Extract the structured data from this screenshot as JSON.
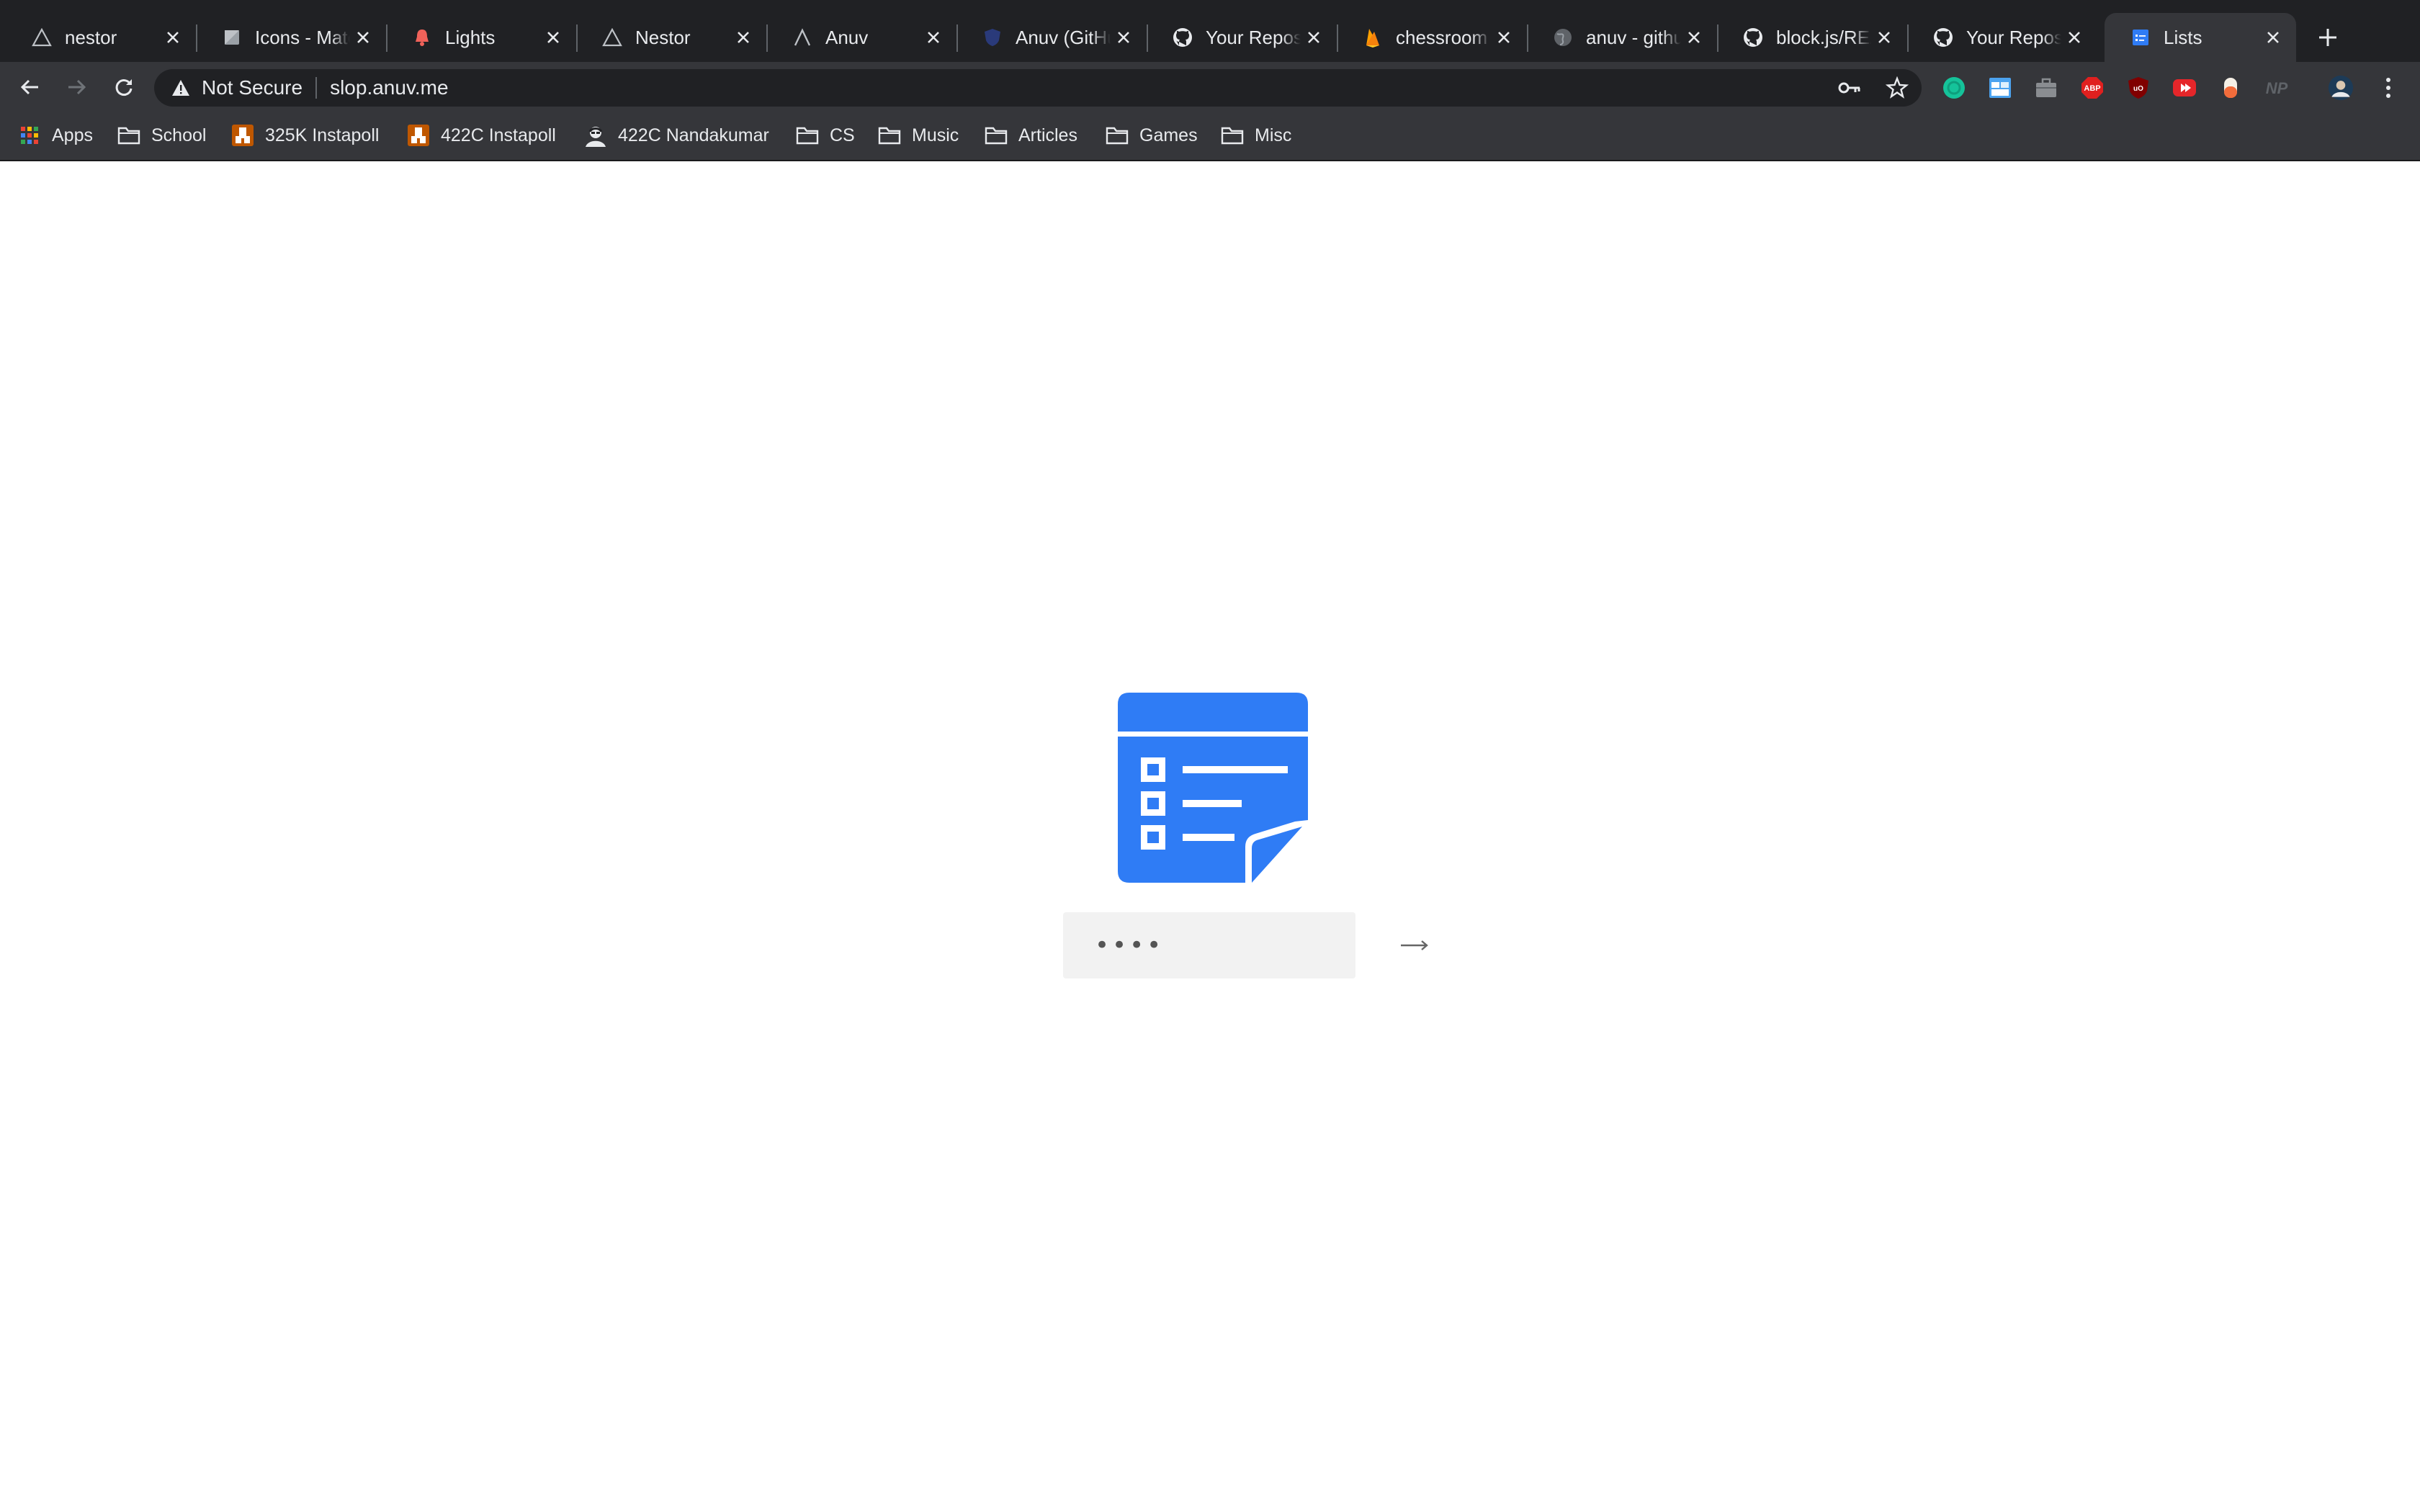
{
  "tabs": [
    {
      "title": "nestor",
      "icon": "triangle-logo-icon"
    },
    {
      "title": "Icons - Material Design",
      "icon": "material-icons-favicon"
    },
    {
      "title": "Lights",
      "icon": "bell-icon"
    },
    {
      "title": "Nestor",
      "icon": "triangle-logo-icon"
    },
    {
      "title": "Anuv",
      "icon": "chevron-logo-icon"
    },
    {
      "title": "Anuv (GitHub)",
      "icon": "shield-icon"
    },
    {
      "title": "Your Repositories",
      "icon": "github-icon"
    },
    {
      "title": "chessroom",
      "icon": "firebase-icon"
    },
    {
      "title": "anuv - github",
      "icon": "globe-icon"
    },
    {
      "title": "block.js/README",
      "icon": "github-icon"
    },
    {
      "title": "Your Repositories",
      "icon": "github-icon"
    },
    {
      "title": "Lists",
      "icon": "lists-app-icon",
      "active": true
    }
  ],
  "toolbar": {
    "security_label": "Not Secure",
    "url": "slop.anuv.me"
  },
  "extensions": [
    "grammarly-icon",
    "tab-manager-icon",
    "briefcase-icon",
    "adblock-plus-icon",
    "ublock-icon",
    "youtube-extension-icon",
    "honey-icon",
    "np-icon",
    "profile-avatar"
  ],
  "bookmarks": [
    {
      "label": "Apps",
      "icon": "apps-grid-icon"
    },
    {
      "label": "School",
      "icon": "folder-icon"
    },
    {
      "label": "325K Instapoll",
      "icon": "instapoll-icon"
    },
    {
      "label": "422C Instapoll",
      "icon": "instapoll-icon"
    },
    {
      "label": "422C Nandakumar",
      "icon": "nandakumar-avatar-icon"
    },
    {
      "label": "CS",
      "icon": "folder-icon"
    },
    {
      "label": "Music",
      "icon": "folder-icon"
    },
    {
      "label": "Articles",
      "icon": "folder-icon"
    },
    {
      "label": "Games",
      "icon": "folder-icon"
    },
    {
      "label": "Misc",
      "icon": "folder-icon"
    }
  ],
  "login": {
    "password_value": "••••",
    "submit_icon": "arrow-right-icon"
  },
  "colors": {
    "chrome_dark": "#202124",
    "toolbar": "#35363a",
    "brand_blue": "#2f7cf5",
    "input_bg": "#f2f2f2"
  }
}
